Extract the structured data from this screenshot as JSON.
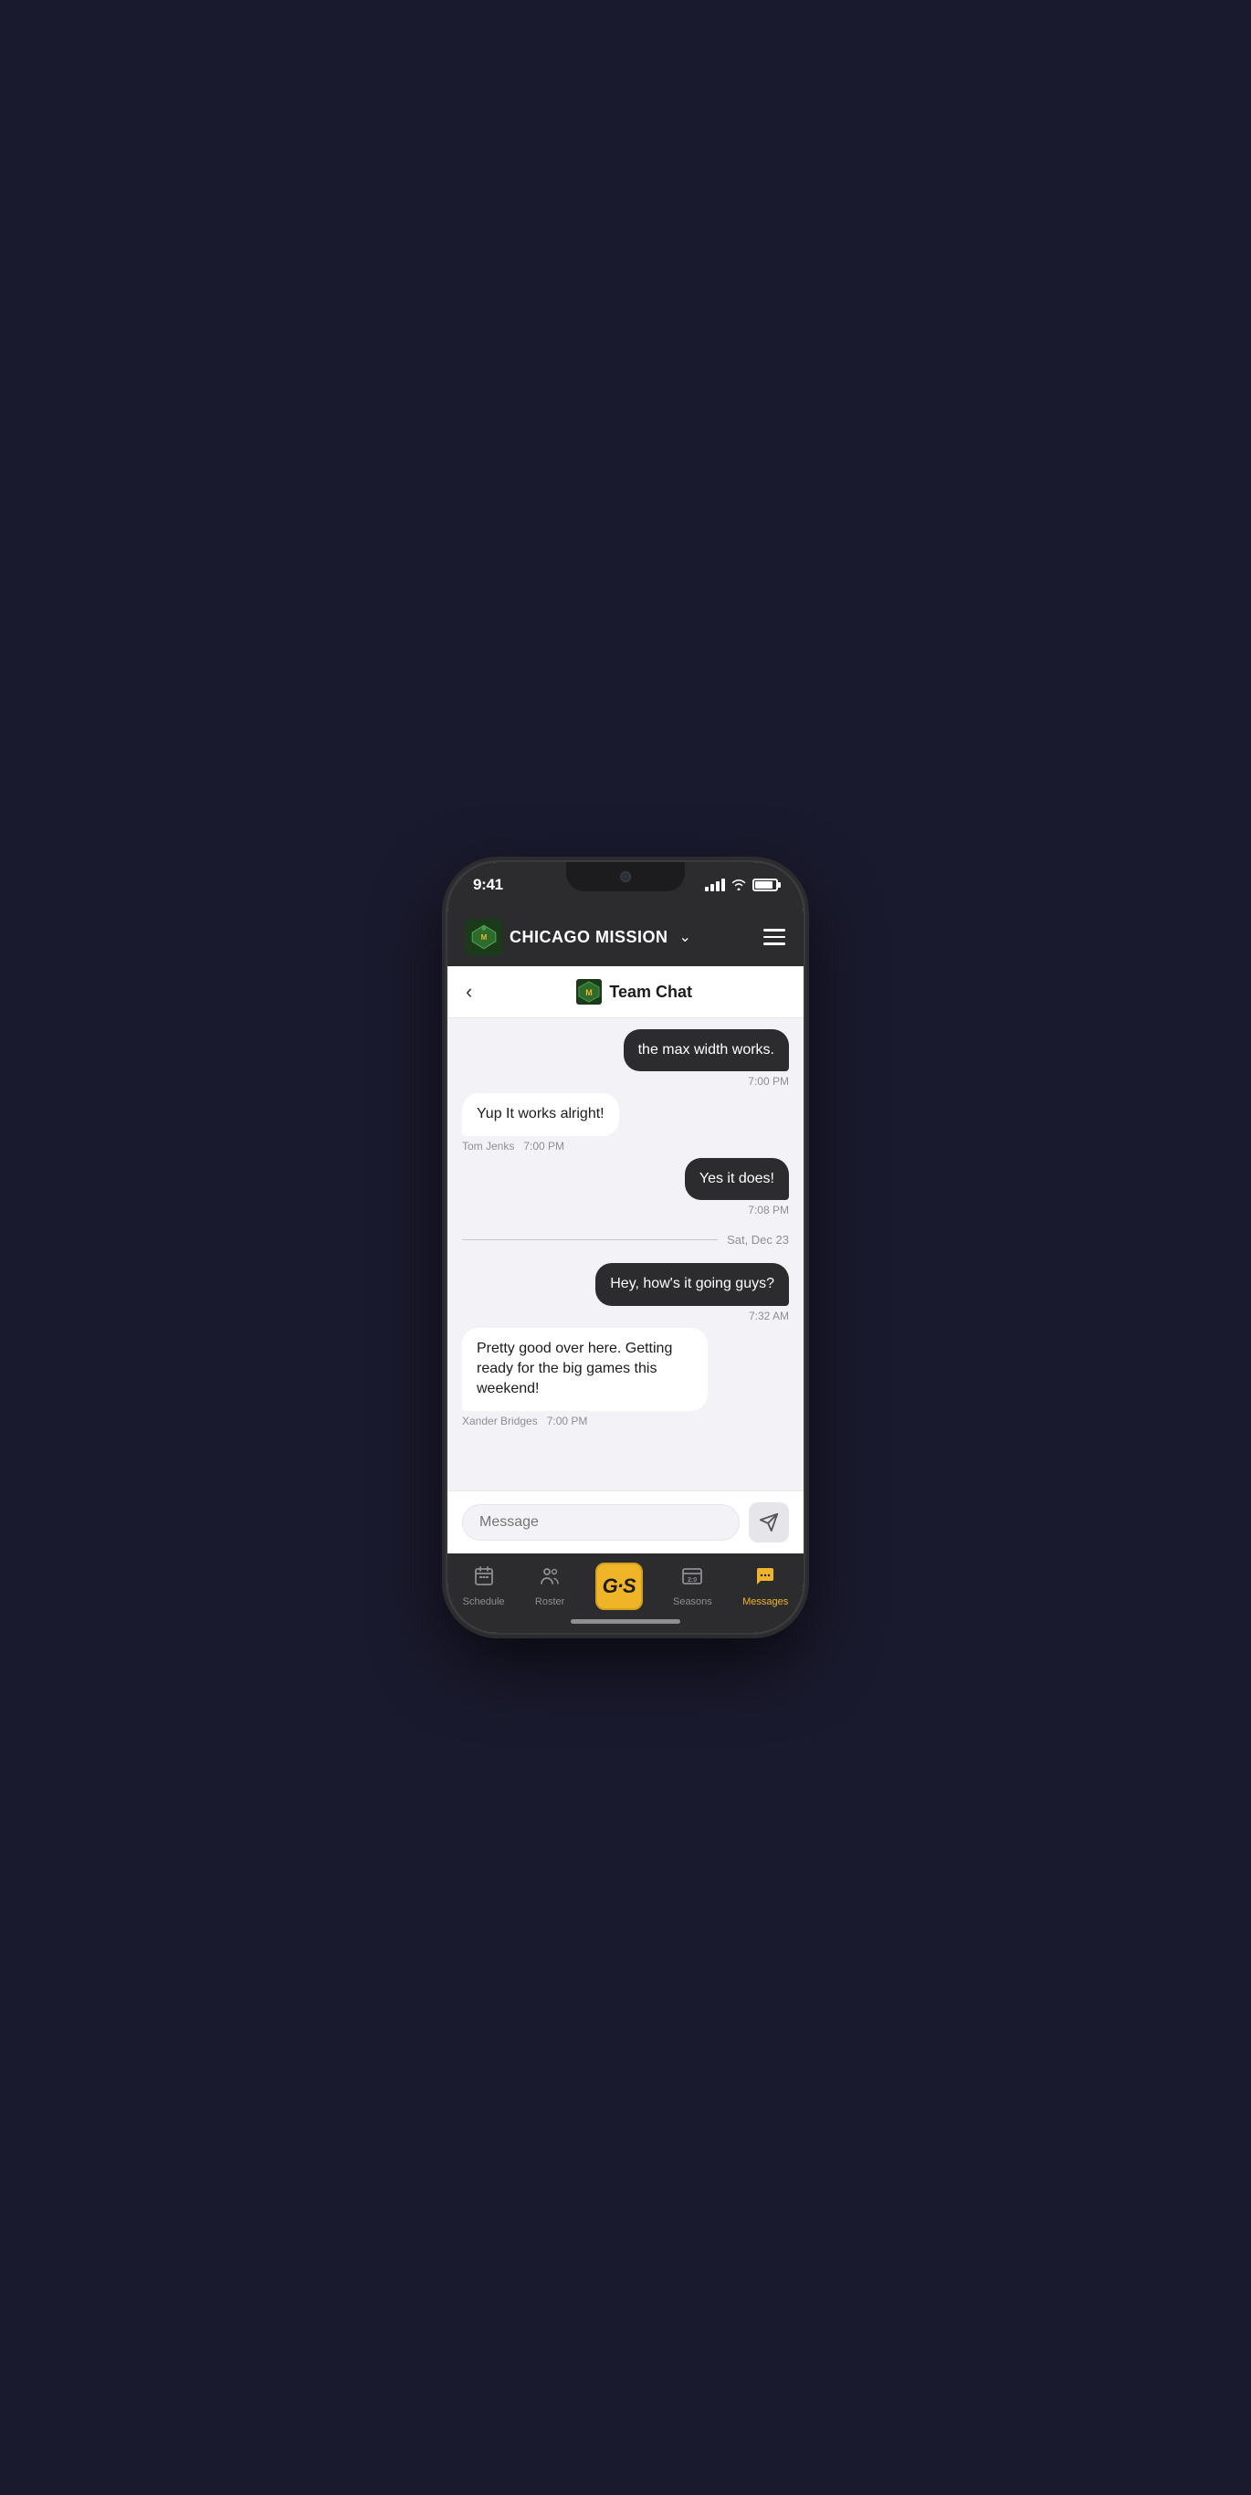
{
  "statusBar": {
    "time": "9:41",
    "signalBars": 4,
    "wifi": true,
    "battery": 85
  },
  "appHeader": {
    "teamName": "CHICAGO MISSION",
    "dropdownLabel": "Chicago Mission dropdown",
    "menuLabel": "Menu"
  },
  "chatHeader": {
    "backLabel": "<",
    "title": "Team Chat"
  },
  "messages": [
    {
      "id": "msg1",
      "type": "sent",
      "text": "the max width works.",
      "time": "7:00 PM",
      "sender": null
    },
    {
      "id": "msg2",
      "type": "received",
      "text": "Yup It works alright!",
      "time": "7:00 PM",
      "sender": "Tom Jenks"
    },
    {
      "id": "msg3",
      "type": "sent",
      "text": "Yes it does!",
      "time": "7:08 PM",
      "sender": null
    },
    {
      "id": "divider1",
      "type": "divider",
      "text": "Sat, Dec 23"
    },
    {
      "id": "msg4",
      "type": "sent",
      "text": "Hey, how's it going guys?",
      "time": "7:32 AM",
      "sender": null
    },
    {
      "id": "msg5",
      "type": "received",
      "text": "Pretty good over here. Getting ready for the big games this weekend!",
      "time": "7:00 PM",
      "sender": "Xander Bridges"
    }
  ],
  "inputArea": {
    "placeholder": "Message",
    "sendLabel": "Send"
  },
  "bottomNav": {
    "items": [
      {
        "id": "schedule",
        "label": "Schedule",
        "icon": "calendar",
        "active": false
      },
      {
        "id": "roster",
        "label": "Roster",
        "icon": "people",
        "active": false
      },
      {
        "id": "home",
        "label": "",
        "icon": "gs-logo",
        "active": false,
        "center": true
      },
      {
        "id": "seasons",
        "label": "Seasons",
        "icon": "scoreboard",
        "active": false
      },
      {
        "id": "messages",
        "label": "Messages",
        "icon": "chat",
        "active": true
      }
    ]
  }
}
